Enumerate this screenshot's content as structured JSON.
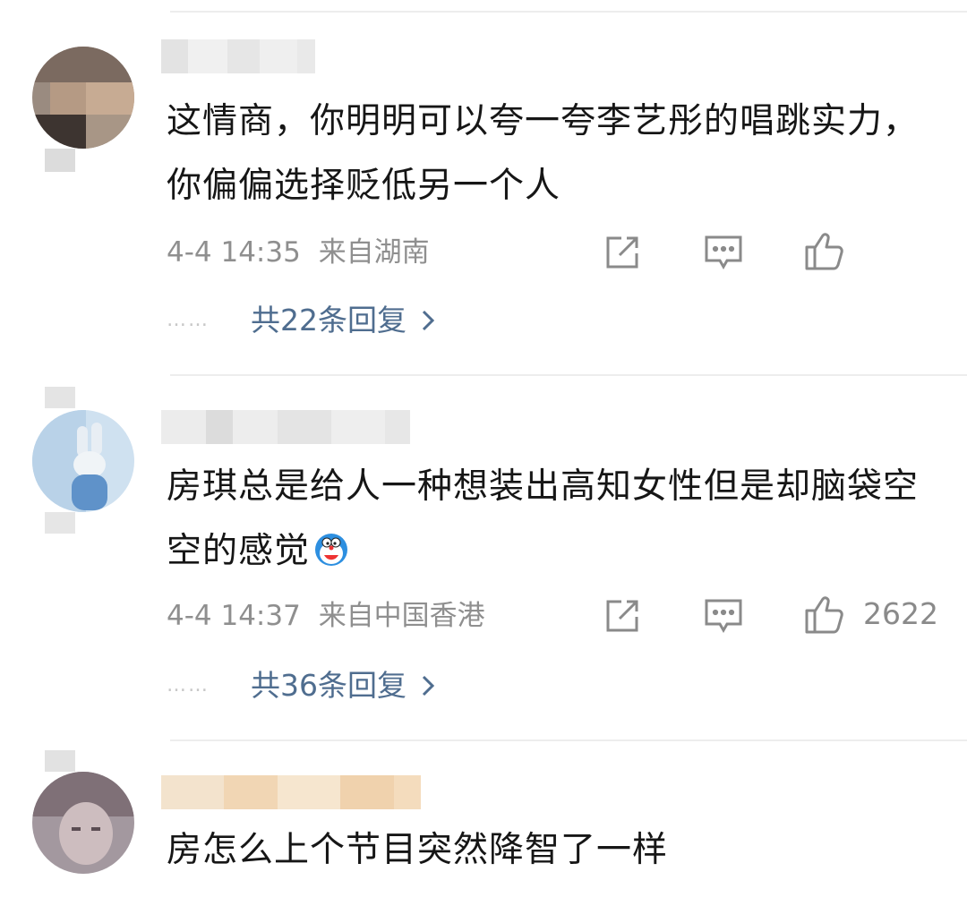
{
  "comments": [
    {
      "text": "这情商，你明明可以夸一夸李艺彤的唱跳实力，你偏偏选择贬低另一个人",
      "date": "4-4 14:35",
      "location": "来自湖南",
      "likes": "",
      "replies": "共22条回复"
    },
    {
      "text": "房琪总是给人一种想装出高知女性但是却脑袋空空的感觉",
      "date": "4-4 14:37",
      "location": "来自中国香港",
      "likes": "2622",
      "replies": "共36条回复"
    },
    {
      "text": "房怎么上个节目突然降智了一样"
    }
  ],
  "icons": {
    "share": "share-icon",
    "comment": "comment-icon",
    "like": "thumbs-up-icon",
    "reply_dots": "ellipsis-icon",
    "chevron": "chevron-right-icon"
  },
  "colors": {
    "text": "#161616",
    "meta": "#8f8f8f",
    "reply_link": "#4f6d8f",
    "divider": "#ededed"
  }
}
